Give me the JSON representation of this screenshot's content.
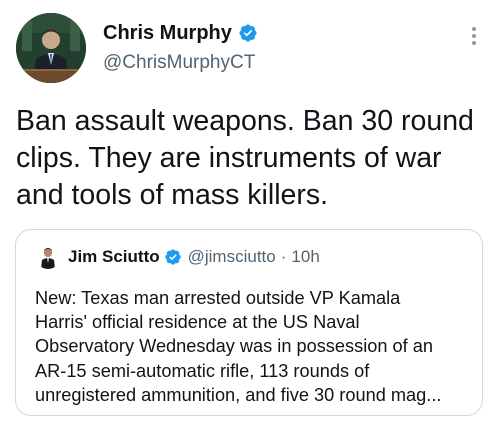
{
  "tweet": {
    "author_name": "Chris Murphy",
    "author_handle": "@ChrisMurphyCT",
    "avatar_icon": "profile-photo",
    "verified_icon": "verified-badge-icon",
    "more_icon": "more-options-icon",
    "text": "Ban assault weapons. Ban 30 round\nclips. They are instruments of war\nand tools of mass killers."
  },
  "quoted_tweet": {
    "author_name": "Jim Sciutto",
    "author_handle": "@jimsciutto",
    "separator": "·",
    "time": "10h",
    "text": "New: Texas man arrested outside VP Kamala\nHarris' official residence at the US Naval\nObservatory Wednesday was in possession of an\nAR-15 semi-automatic rifle, 113 rounds of\nunregistered ammunition, and five 30 round mag..."
  },
  "colors": {
    "verified_blue": "#1d9bf0",
    "secondary_text": "#536471",
    "border": "#cfd9de"
  }
}
